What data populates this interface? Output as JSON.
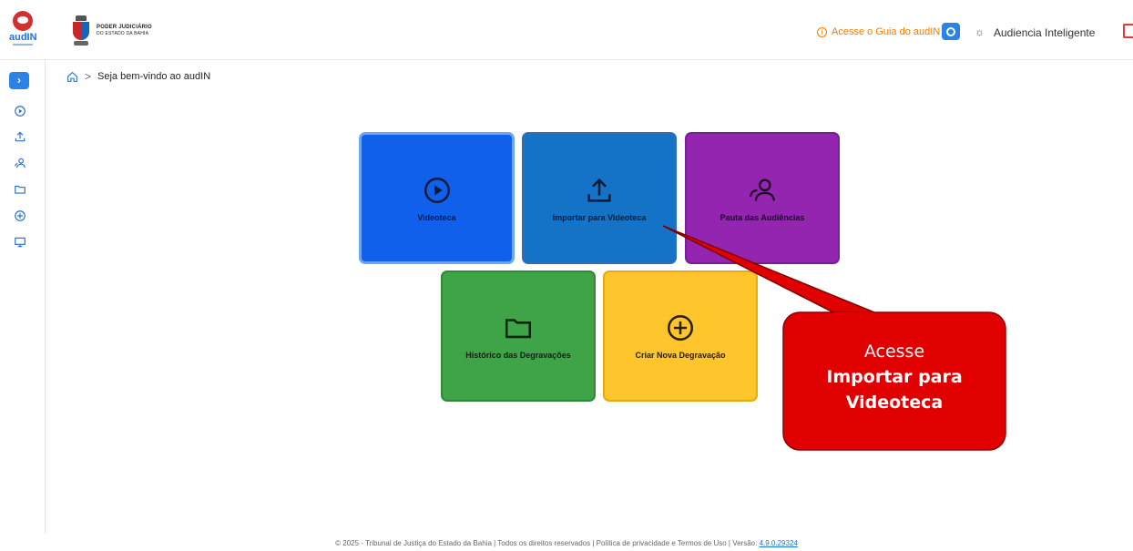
{
  "header": {
    "app_logo_text": "audIN",
    "org_name_line1": "PODER JUDICIÁRIO",
    "org_name_line2": "DO ESTADO DA BAHIA",
    "guide_link": "Acesse o Guia do audIN",
    "mode_label": "Audiencia Inteligente",
    "accent_color": "#2b83e6",
    "guide_color": "#f57c00"
  },
  "sidebar": {
    "expand_glyph": "›",
    "items": [
      {
        "icon": "play-circle-icon"
      },
      {
        "icon": "upload-icon"
      },
      {
        "icon": "people-icon"
      },
      {
        "icon": "folder-icon"
      },
      {
        "icon": "plus-circle-icon"
      },
      {
        "icon": "monitor-icon"
      }
    ]
  },
  "breadcrumb": {
    "separator": ">",
    "current": "Seja bem-vindo ao audIN"
  },
  "tiles": [
    {
      "label": "Videoteca",
      "icon": "play-circle-icon",
      "color": "#1160ec"
    },
    {
      "label": "Importar para Videoteca",
      "icon": "upload-icon",
      "color": "#1573c7"
    },
    {
      "label": "Pauta das Audiências",
      "icon": "people-icon",
      "color": "#9325b0"
    },
    {
      "label": "Histórico das Degravações",
      "icon": "folder-icon",
      "color": "#3ea447"
    },
    {
      "label": "Criar Nova Degravação",
      "icon": "plus-circle-icon",
      "color": "#ffc52c"
    }
  ],
  "callout": {
    "line1": "Acesse",
    "line2": "Importar para",
    "line3": "Videoteca",
    "color": "#e00000"
  },
  "footer": {
    "text": "© 2025 - Tribunal de Justiça do Estado da Bahia | Todos os direitos reservados | Política de privacidade e Termos de Uso | Versão: ",
    "version": "4.9.0.29324"
  }
}
